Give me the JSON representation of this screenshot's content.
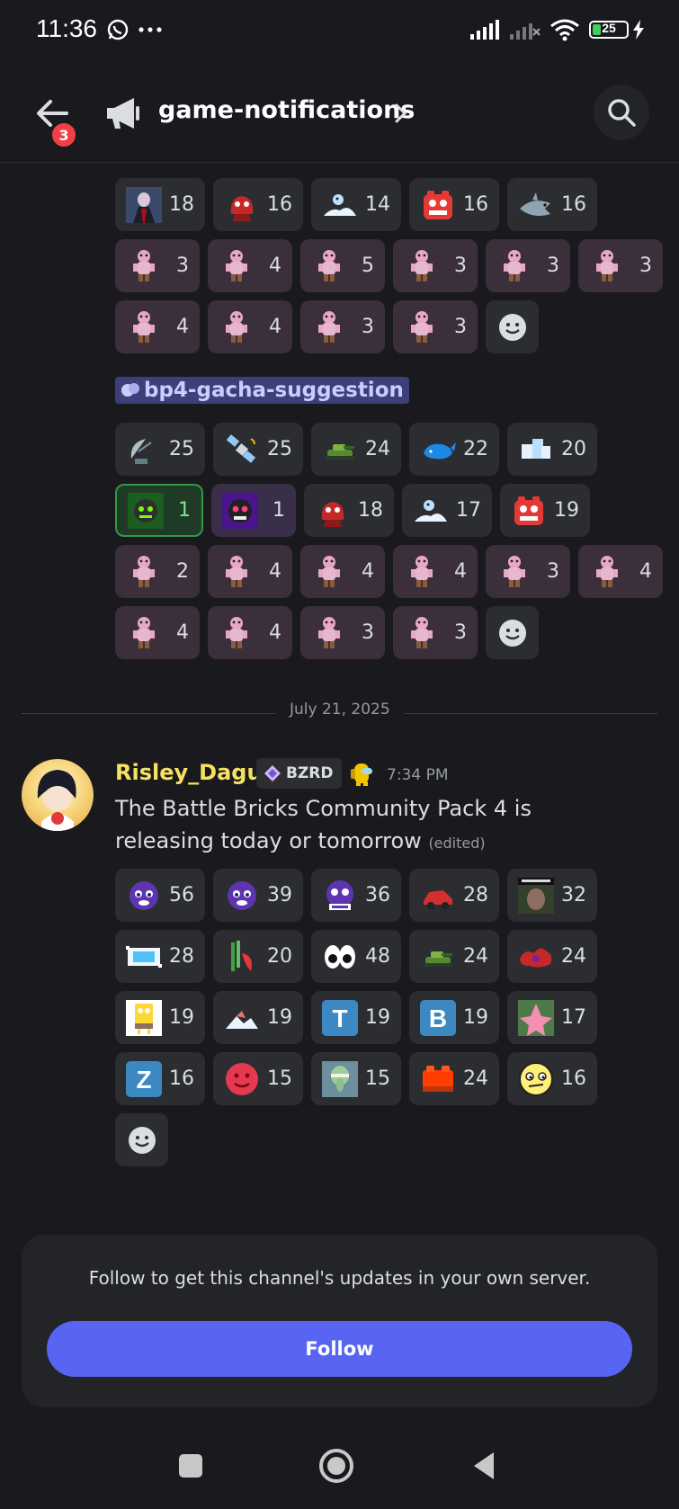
{
  "status": {
    "time": "11:36",
    "battery": "25",
    "battery_fraction": 0.25
  },
  "header": {
    "back_badge": "3",
    "channel_name": "game-notifications"
  },
  "reactions_top": {
    "rows": [
      [
        {
          "icon": "dark-figure",
          "count": "18"
        },
        {
          "icon": "red-creature",
          "count": "16"
        },
        {
          "icon": "ice-mound",
          "count": "14"
        },
        {
          "icon": "red-brick-face",
          "count": "16"
        },
        {
          "icon": "shark",
          "count": "16"
        }
      ],
      [
        {
          "icon": "pink-doll",
          "count": "3",
          "me": true
        },
        {
          "icon": "pink-doll",
          "count": "4",
          "me": true
        },
        {
          "icon": "pink-doll",
          "count": "5",
          "me": true
        },
        {
          "icon": "pink-doll",
          "count": "3",
          "me": true
        },
        {
          "icon": "pink-doll",
          "count": "3",
          "me": true
        },
        {
          "icon": "pink-doll",
          "count": "3",
          "me": true
        }
      ],
      [
        {
          "icon": "pink-doll",
          "count": "4",
          "me": true
        },
        {
          "icon": "pink-doll",
          "count": "4",
          "me": true
        },
        {
          "icon": "pink-doll",
          "count": "3",
          "me": true
        },
        {
          "icon": "pink-doll",
          "count": "3",
          "me": true
        },
        {
          "icon": "add-reaction",
          "count": ""
        }
      ]
    ]
  },
  "mention": {
    "label": "bp4-gacha-suggestion"
  },
  "reactions_mid": {
    "rows": [
      [
        {
          "icon": "satellite-dish",
          "count": "25"
        },
        {
          "icon": "satellite",
          "count": "25"
        },
        {
          "icon": "green-tank",
          "count": "24"
        },
        {
          "icon": "whale",
          "count": "22"
        },
        {
          "icon": "ice-block",
          "count": "20"
        }
      ],
      [
        {
          "icon": "green-robot",
          "count": "1",
          "style": "green"
        },
        {
          "icon": "pink-robot",
          "count": "1",
          "style": "purple"
        },
        {
          "icon": "red-creature",
          "count": "18"
        },
        {
          "icon": "ice-mound",
          "count": "17"
        },
        {
          "icon": "red-brick-face",
          "count": "19"
        }
      ],
      [
        {
          "icon": "pink-doll",
          "count": "2",
          "me": true
        },
        {
          "icon": "pink-doll",
          "count": "4",
          "me": true
        },
        {
          "icon": "pink-doll",
          "count": "4",
          "me": true
        },
        {
          "icon": "pink-doll",
          "count": "4",
          "me": true
        },
        {
          "icon": "pink-doll",
          "count": "3",
          "me": true
        },
        {
          "icon": "pink-doll",
          "count": "4",
          "me": true
        }
      ],
      [
        {
          "icon": "pink-doll",
          "count": "4",
          "me": true
        },
        {
          "icon": "pink-doll",
          "count": "4",
          "me": true
        },
        {
          "icon": "pink-doll",
          "count": "3",
          "me": true
        },
        {
          "icon": "pink-doll",
          "count": "3",
          "me": true
        },
        {
          "icon": "add-reaction",
          "count": ""
        }
      ]
    ]
  },
  "divider": {
    "date": "July 21, 2025"
  },
  "message": {
    "username": "Risley_Dagul",
    "tag": "BZRD",
    "timestamp": "7:34 PM",
    "text": "The Battle Bricks Community Pack 4 is releasing today or tomorrow",
    "edited": "(edited)"
  },
  "reactions_msg": {
    "rows": [
      [
        {
          "icon": "blue-blob",
          "count": "56"
        },
        {
          "icon": "blue-blob",
          "count": "39"
        },
        {
          "icon": "blue-blob-text",
          "count": "36"
        },
        {
          "icon": "red-car",
          "count": "28"
        },
        {
          "icon": "photo-meme",
          "count": "32"
        }
      ],
      [
        {
          "icon": "cyan-frame",
          "count": "28"
        },
        {
          "icon": "bamboo-chili",
          "count": "20"
        },
        {
          "icon": "eyes",
          "count": "48"
        },
        {
          "icon": "green-tank",
          "count": "24"
        },
        {
          "icon": "red-splatter",
          "count": "24"
        }
      ],
      [
        {
          "icon": "sponge",
          "count": "19"
        },
        {
          "icon": "ice-mound-pink",
          "count": "19"
        },
        {
          "icon": "letter-t",
          "count": "19"
        },
        {
          "icon": "letter-b",
          "count": "19"
        },
        {
          "icon": "patrick",
          "count": "17"
        }
      ],
      [
        {
          "icon": "letter-z",
          "count": "16"
        },
        {
          "icon": "red-smiley",
          "count": "15"
        },
        {
          "icon": "squidward",
          "count": "15"
        },
        {
          "icon": "red-brick",
          "count": "24"
        },
        {
          "icon": "yellow-face",
          "count": "16"
        }
      ],
      [
        {
          "icon": "add-reaction",
          "count": ""
        }
      ]
    ]
  },
  "follow": {
    "text": "Follow to get this channel's updates in your own server.",
    "button": "Follow"
  }
}
